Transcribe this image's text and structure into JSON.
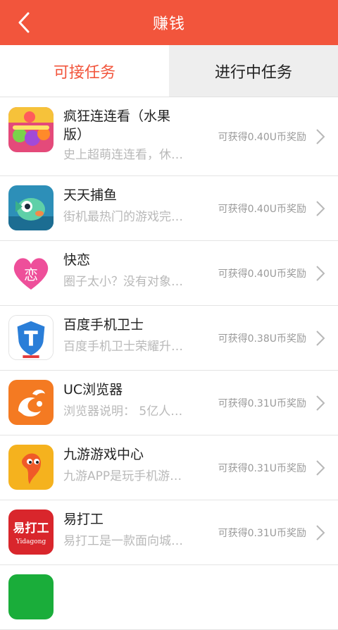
{
  "header": {
    "title": "赚钱"
  },
  "tabs": [
    {
      "label": "可接任务"
    },
    {
      "label": "进行中任务"
    }
  ],
  "items": [
    {
      "name": "疯狂连连看（水果版）",
      "desc": "史上超萌连连看，休…",
      "reward": "可获得0.40U币奖励",
      "icon": "fruit-game-icon"
    },
    {
      "name": "天天捕鱼",
      "desc": "街机最热门的游戏完…",
      "reward": "可获得0.40U币奖励",
      "icon": "fish-game-icon"
    },
    {
      "name": "快恋",
      "desc": "圈子太小？没有对象…",
      "reward": "可获得0.40U币奖励",
      "icon": "heart-love-icon"
    },
    {
      "name": "百度手机卫士",
      "desc": "百度手机卫士荣耀升…",
      "reward": "可获得0.38U币奖励",
      "icon": "shield-icon"
    },
    {
      "name": "UC浏览器",
      "desc": "浏览器说明： 5亿人…",
      "reward": "可获得0.31U币奖励",
      "icon": "uc-squirrel-icon"
    },
    {
      "name": "九游游戏中心",
      "desc": "九游APP是玩手机游…",
      "reward": "可获得0.31U币奖励",
      "icon": "jiuyou-icon"
    },
    {
      "name": "易打工",
      "desc": "易打工是一款面向城…",
      "reward": "可获得0.31U币奖励",
      "icon": "yidagong-icon"
    }
  ],
  "logo_texts": {
    "yidagong_cn": "易打工",
    "yidagong_en": "Yidagong",
    "love_char": "恋"
  }
}
